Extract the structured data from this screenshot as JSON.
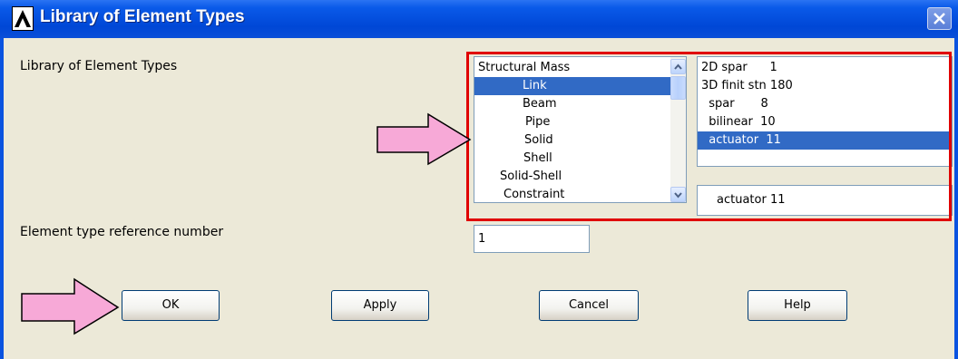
{
  "window": {
    "title": "Library of Element Types",
    "colors": {
      "titlebar": "#0a53e0",
      "body": "#ece9d8",
      "selection": "#316ac5",
      "highlight_border": "#e00000",
      "arrow_fill": "#f7a9d7"
    }
  },
  "form": {
    "library_label": "Library of Element Types",
    "ref_label": "Element type reference number",
    "ref_value": "1"
  },
  "category_list": {
    "items": [
      "Structural Mass",
      "Link",
      "Beam",
      "Pipe",
      "Solid",
      "Shell",
      "Solid-Shell",
      "Constraint"
    ],
    "selected": "Link"
  },
  "type_list": {
    "items": [
      "2D spar      1",
      "3D finit stn 180",
      "  spar       8",
      "  bilinear  10",
      "  actuator  11"
    ],
    "selected": "  actuator  11"
  },
  "selected_field": {
    "value": "actuator  11"
  },
  "buttons": {
    "ok": "OK",
    "apply": "Apply",
    "cancel": "Cancel",
    "help": "Help"
  },
  "icons": {
    "logo": "ansys-logo-icon",
    "close": "close-icon",
    "scroll_up": "chevron-up-icon",
    "scroll_down": "chevron-down-icon",
    "annotation_arrow": "arrow-right-icon"
  }
}
